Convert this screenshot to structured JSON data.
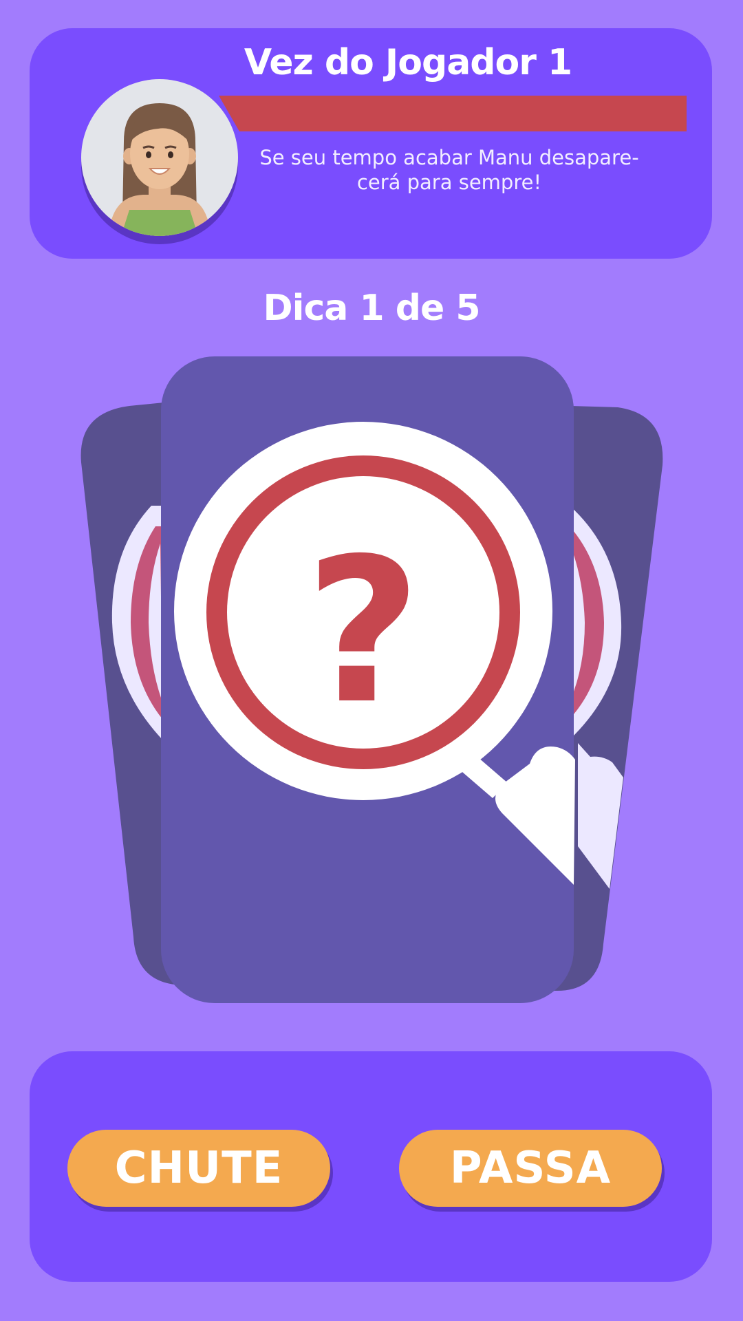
{
  "header": {
    "turn_title": "Vez do Jogador 1",
    "timer_remaining": 1.0,
    "warning_line1": "Se seu tempo acabar Manu desapare-",
    "warning_line2": "cerá para sempre!",
    "timer_color": "#c6474f"
  },
  "avatar": {
    "icon": "girl-avatar-icon"
  },
  "hint": {
    "label": "Dica 1 de 5",
    "current": 1,
    "total": 5
  },
  "card": {
    "icon": "magnifier-question-icon",
    "symbol": "?"
  },
  "actions": {
    "guess_label": "CHUTE",
    "pass_label": "PASSA"
  },
  "colors": {
    "background": "#a27cfd",
    "panel": "#7a4dfe",
    "card_front": "#6257ad",
    "card_back": "#58508f",
    "accent_red": "#c6474f",
    "button": "#f4a94f"
  }
}
